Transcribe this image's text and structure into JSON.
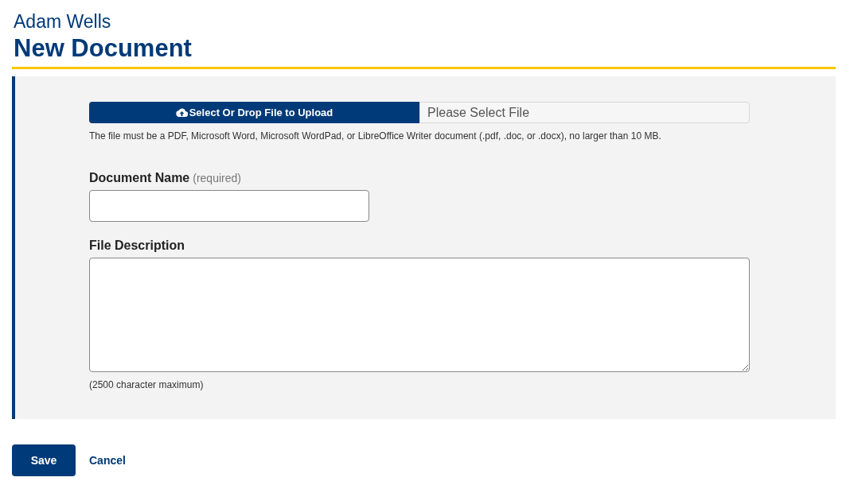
{
  "header": {
    "subtitle": "Adam Wells",
    "title": "New Document"
  },
  "upload": {
    "button": "Select Or Drop File to Upload",
    "placeholder": "Please Select File",
    "hint": "The file must be a PDF, Microsoft Word, Microsoft WordPad, or LibreOffice Writer document (.pdf, .doc, or .docx), no larger than 10 MB."
  },
  "fields": [
    {
      "kind": "input",
      "label": "Document Name",
      "required_note": "(required)"
    },
    {
      "kind": "textarea",
      "label": "File Description",
      "note": "(2500 character maximum)"
    }
  ],
  "actions": {
    "save": "Save",
    "cancel": "Cancel"
  }
}
